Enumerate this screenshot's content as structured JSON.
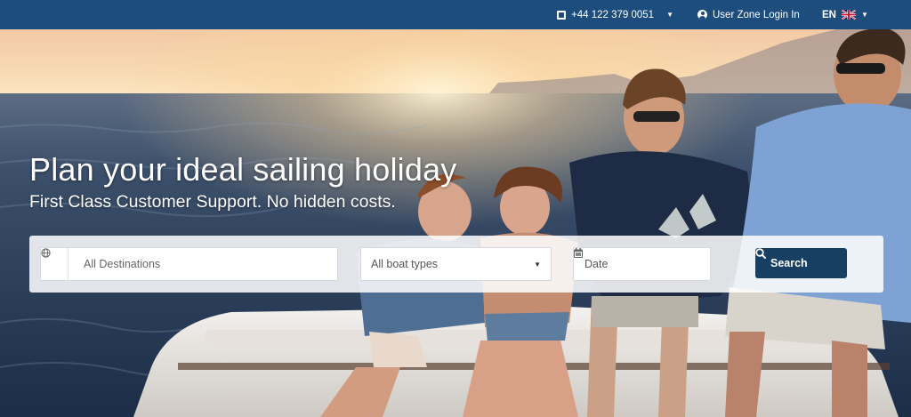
{
  "topbar": {
    "phone": "+44 122 379 0051",
    "phone_icon": "phone-icon",
    "user_zone": "User Zone Login In",
    "user_icon": "user-icon",
    "language": "EN",
    "flag_icon": "uk-flag-icon",
    "caret": "▼"
  },
  "hero": {
    "title": "Plan your ideal sailing holiday",
    "subtitle": "First Class Customer Support. No hidden costs."
  },
  "search": {
    "destination_placeholder": "All Destinations",
    "globe_icon": "globe-icon",
    "boat_type": "All boat types",
    "date_placeholder": "Date",
    "calendar_icon": "calendar-icon",
    "button_label": "Search",
    "search_icon": "search-icon",
    "caret": "▼"
  },
  "colors": {
    "topbar": "#1c4d7d",
    "search_button": "#173e63"
  }
}
